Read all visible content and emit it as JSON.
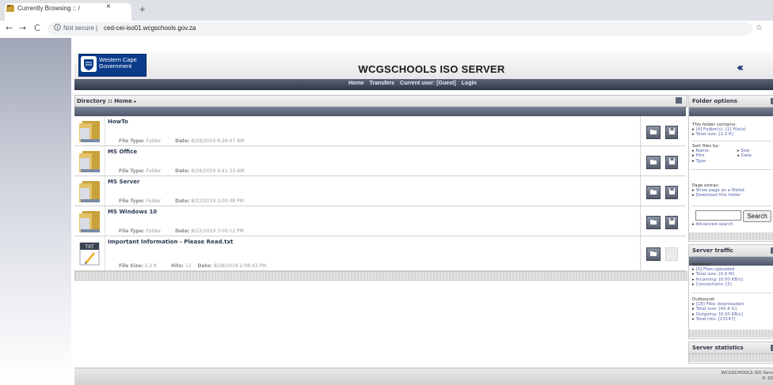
{
  "browser": {
    "tab_title": "Currently Browsing :: /",
    "tab_close": "×",
    "new_tab": "+",
    "back": "←",
    "forward": "→",
    "reload": "C",
    "not_secure": "Not secure",
    "separator": "|",
    "url": "ced-cei-iso01.wcgschools.gov.za",
    "star": "☆"
  },
  "header": {
    "logo_line1": "Western Cape",
    "logo_line2": "Government",
    "title": "WCGSCHOOLS ISO SERVER",
    "arrows": "‹‹‹"
  },
  "nav": {
    "home": "Home",
    "transfers": "Transfers",
    "current_user": "Current user: [Guest]",
    "login": "Login"
  },
  "directory": {
    "title": "Directory :: Home",
    "rows": [
      {
        "name": "HowTo",
        "type_label": "File Type:",
        "type": "Folder",
        "date_label": "Date:",
        "date": "8/28/2019 9:26:47 AM"
      },
      {
        "name": "MS Office",
        "type_label": "File Type:",
        "type": "Folder",
        "date_label": "Date:",
        "date": "8/28/2019 9:41:33 AM"
      },
      {
        "name": "MS Server",
        "type_label": "File Type:",
        "type": "Folder",
        "date_label": "Date:",
        "date": "8/22/2019 3:00:08 PM"
      },
      {
        "name": "MS Windows 10",
        "type_label": "File Type:",
        "type": "Folder",
        "date_label": "Date:",
        "date": "8/22/2019 3:00:12 PM"
      },
      {
        "name": "Important Information - Please Read.txt",
        "size_label": "File Size:",
        "size": "1.2 K",
        "hits_label": "Hits:",
        "hits": "12",
        "date_label": "Date:",
        "date": "8/28/2019 2:08:43 PM",
        "icon_text": "TXT"
      }
    ]
  },
  "folder_options": {
    "title": "Folder options",
    "contains_label": "This folder contains:",
    "contains_line1": "[4] Folder(s), [1] File(s)",
    "contains_line2": "Total size: [1.2 K]",
    "sort_label": "Sort files by:",
    "sort_name": "Name",
    "sort_size": "Size",
    "sort_hits": "Hits",
    "sort_date": "Date",
    "sort_type": "Type",
    "extras_label": "Page extras:",
    "extra1": "Show page as a filelist",
    "extra2": "Download this folder",
    "search_button": "Search",
    "advanced": "Advanced search"
  },
  "server_traffic": {
    "title": "Server traffic",
    "inbound_label": "Inbound:",
    "in1": "[0] Files uploaded",
    "in2": "Total size: [0.0 M]",
    "in3": "Incoming: [0.00 KB/s]",
    "in4": "Connections: [2]",
    "outbound_label": "Outbound:",
    "out1": "[18] Files downloaded",
    "out2": "Total size: [40.4 G]",
    "out3": "Outgoing: [0.00 KB/s]",
    "out4": "Total hits: [23147]"
  },
  "server_statistics": {
    "title": "Server statistics"
  },
  "footer": {
    "line1": "WCGSCHOOLS ISO Serv",
    "line2": "© 20"
  },
  "colors": {
    "accent": "#0b3c8a",
    "nav": "#2f3746"
  }
}
